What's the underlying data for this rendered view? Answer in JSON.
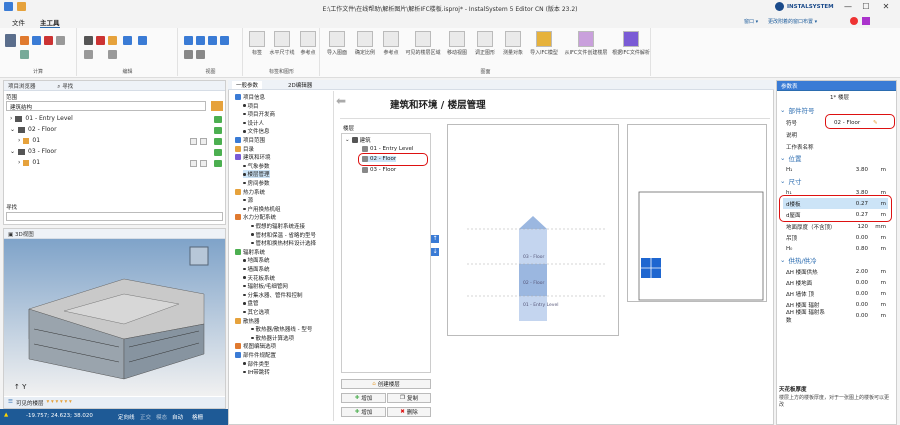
{
  "window": {
    "title": "E:\\工作文件\\在线帮助\\解析图片\\解析IFC楼板.isproj* - InstalSystem 5 Editor CN (版本 23.2)",
    "brand": "INSTALSYSTEM",
    "min": "—",
    "max": "☐",
    "close": "✕"
  },
  "menu": {
    "file": "文件",
    "main": "主工具",
    "right1": "窗口 ▾",
    "right2": "更改附着的窗口布置 ▾"
  },
  "ribbon": {
    "groups": [
      "计算",
      "编辑",
      "视图",
      "标签和图形",
      "图面"
    ],
    "tools": [
      "标签",
      "水平尺寸线",
      "参考点",
      "参考点",
      "可见的楼层区域",
      "移动视图",
      "调正图形",
      "测量对象",
      "导入IFC模型",
      "从IFC文件创建楼层",
      "根据IFC文件解析"
    ],
    "tools_short": [
      "导入图面",
      "确定比例"
    ]
  },
  "project_tree": {
    "tab1": "项目浏览器",
    "tab2": "寻找",
    "scope_label": "范围",
    "scope_value": "建筑结构",
    "rows": [
      "01 - Entry Level",
      "02 - Floor",
      "01",
      "03 - Floor",
      "01"
    ],
    "search_label": "寻找"
  },
  "view3d": {
    "title": "3D视图",
    "visible_floors": "可见的楼层"
  },
  "status": {
    "coords": "-19.757; 24.623; 38.020",
    "modes": [
      "定向线",
      "正交",
      "模态",
      "自动",
      "格栅"
    ]
  },
  "dialog": {
    "tabs": [
      "一般参数",
      "2D编辑器"
    ],
    "title": "建筑和环境 / 楼层管理",
    "nav": [
      "项目信息",
      "项目",
      "项目开发商",
      "设计人",
      "文件信息",
      "项目范围",
      "目录",
      "建筑和环境",
      "气象参数",
      "楼层管理",
      "房间参数",
      "热力系统",
      "源",
      "户用换热机组",
      "水力分配系统",
      "假想的辐射系统连接",
      "管材和保温 - 省略的型号",
      "管材和换热材料设计选择",
      "辐射系统",
      "地面系统",
      "墙面系统",
      "天花板系统",
      "辐射板/毛细管网",
      "分集水器、管件和控制",
      "盘管",
      "其它选项",
      "散热器",
      "散热器/散热器线 - 型号",
      "散热器计算选项",
      "视图编辑选项",
      "部件件规配置",
      "部件类型",
      "IH带跳转"
    ],
    "floors_label": "楼层",
    "floor_tree": [
      "建筑",
      "01 - Entry Level",
      "02 - Floor",
      "03 - Floor"
    ],
    "create_floor": "创建楼层",
    "copy": "复制",
    "add": "增加",
    "delete": "删除",
    "preview_labels": [
      "03 - Floor",
      "02 - Floor",
      "01 - Entry Level"
    ]
  },
  "props": {
    "header": "参数表",
    "top_value": "1* 楼层",
    "sections": [
      "部件符号",
      "位置",
      "尺寸",
      "供热/供冷"
    ],
    "rows": [
      {
        "k": "符号",
        "v": "02 - Floor",
        "u": ""
      },
      {
        "k": "说明",
        "v": "",
        "u": ""
      },
      {
        "k": "工作表名称",
        "v": "",
        "u": ""
      },
      {
        "k": "H₁",
        "v": "3.80",
        "u": "m"
      },
      {
        "k": "h₁",
        "v": "3.80",
        "u": "m"
      },
      {
        "k": "d楼板",
        "v": "0.27",
        "u": "m"
      },
      {
        "k": "d屋面",
        "v": "0.27",
        "u": "m"
      },
      {
        "k": "地面厚度（不含顶）",
        "v": "120",
        "u": "mm"
      },
      {
        "k": "吊顶",
        "v": "0.00",
        "u": "m"
      },
      {
        "k": "H₀",
        "v": "0.80",
        "u": "m"
      },
      {
        "k": "ΔH 楼面供热",
        "v": "2.00",
        "u": "m"
      },
      {
        "k": "ΔH 楼地面",
        "v": "0.00",
        "u": "m"
      },
      {
        "k": "ΔH 墙体 顶",
        "v": "0.00",
        "u": "m"
      },
      {
        "k": "ΔH 楼面 辐射",
        "v": "0.00",
        "u": "m"
      },
      {
        "k": "ΔH 楼面 辐射系数",
        "v": "0.00",
        "u": "m"
      }
    ],
    "hint_title": "天花板厚度",
    "hint_text": "楼层上方的楼板厚度，对于一张图上的楼板可以更改"
  }
}
